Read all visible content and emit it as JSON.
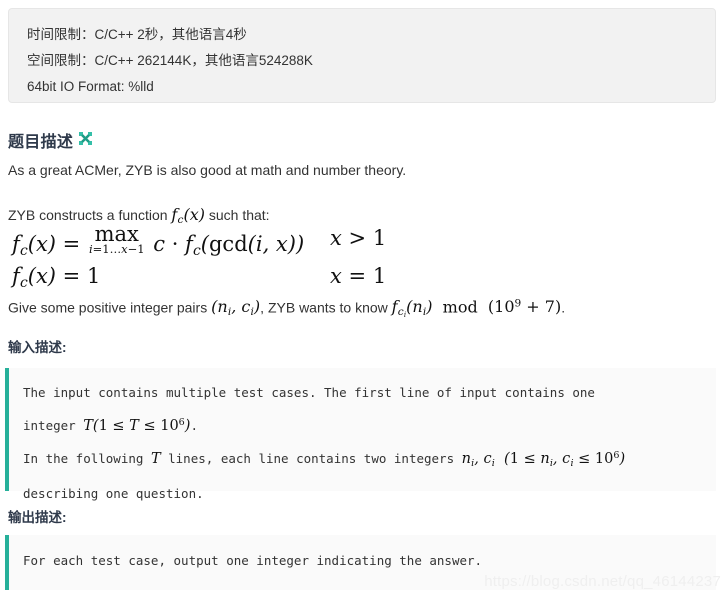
{
  "limits": {
    "time_limit": "时间限制：C/C++ 2秒，其他语言4秒",
    "memory_limit": "空间限制：C/C++ 262144K，其他语言524288K",
    "io_format": "64bit IO Format: %lld"
  },
  "description": {
    "heading": "题目描述",
    "anchor_icon": "link-anchor-icon",
    "paragraph1": "As a great ACMer, ZYB is also good at math and number theory.",
    "paragraph2_prefix": "ZYB constructs a function ",
    "paragraph2_math": "f_c(x)",
    "paragraph2_suffix": " such that:",
    "equation1_left": "f_c(x) = max_{i=1...x-1} c · f_c(gcd(i,x))",
    "equation1_cond": "x > 1",
    "equation2_left": "f_c(x) = 1",
    "equation2_cond": "x = 1",
    "paragraph3_a": "Give some positive integer pairs ",
    "paragraph3_math1": "(n_i, c_i)",
    "paragraph3_b": ", ZYB wants to know ",
    "paragraph3_math2": "f_{c_i}(n_i)",
    "paragraph3_c": "  mod  ",
    "paragraph3_math3": "(10^9 + 7)",
    "paragraph3_d": "."
  },
  "input_section": {
    "heading": "输入描述:",
    "line1": "The input contains multiple test cases. The first line of input contains one",
    "line2_prefix": "integer ",
    "line2_math": "T(1 ≤ T ≤ 10^6)",
    "line2_suffix": ".",
    "line3_prefix": "In the following ",
    "line3_math_T": "T",
    "line3_mid": " lines, each line contains two integers ",
    "line3_math_vars": "n_i, c_i",
    "line3_math_range": "(1 ≤ n_i, c_i ≤ 10^6)",
    "line4": "describing one question."
  },
  "output_section": {
    "heading": "输出描述:",
    "line1": "For each test case, output one integer indicating the answer."
  },
  "watermark": "https://blog.csdn.net/qq_46144237",
  "colors": {
    "accent_teal": "#26b09a",
    "heading_navy": "#2f3a4b",
    "box_bg": "#f2f2f2",
    "code_bg": "#fafafa",
    "body_text": "#333333"
  }
}
